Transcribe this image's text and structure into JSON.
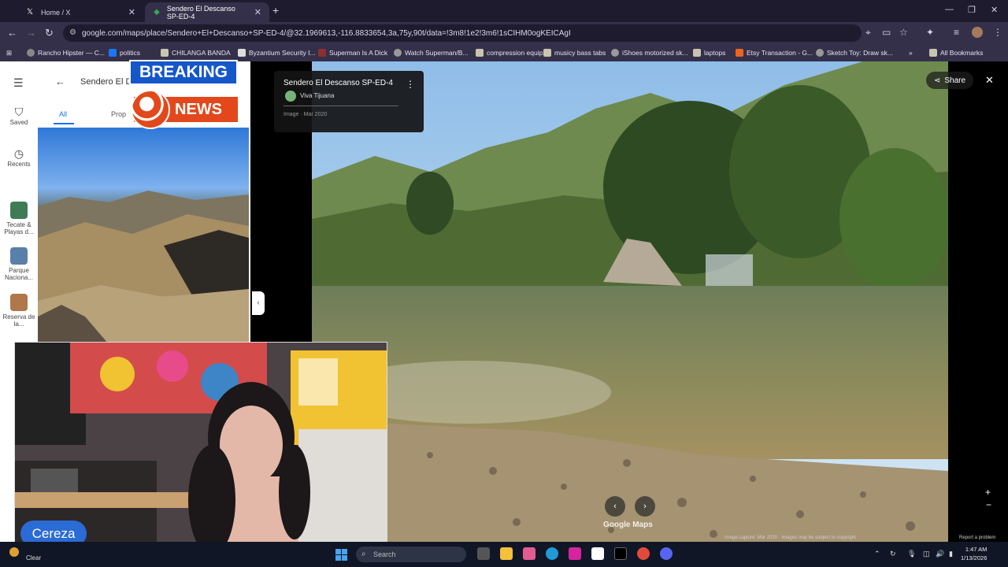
{
  "tabs": [
    {
      "label": "Home / X",
      "icon": "x-logo-icon"
    },
    {
      "label": "Sendero El Descanso SP-ED-4",
      "icon": "google-maps-icon"
    }
  ],
  "url": "google.com/maps/place/Sendero+El+Descanso+SP-ED-4/@32.1969613,-116.8833654,3a,75y,90t/data=!3m8!1e2!3m6!1sCIHM0ogKEICAgI",
  "bookmarks": [
    "Rancho Hipster — C...",
    "politics",
    "CHILANGA BANDA",
    "Byzantium Security I...",
    "Superman Is A Dick",
    "Watch Superman/B...",
    "compression equip",
    "musicy bass tabs",
    "iShoes motorized sk...",
    "laptops",
    "Etsy Transaction - G...",
    "Sketch Toy: Draw sk..."
  ],
  "all_bookmarks": "All Bookmarks",
  "rail": {
    "saved": "Saved",
    "recents": "Recents",
    "items": [
      "Tecate & Playas d...",
      "Parque Naciona...",
      "Reserva de la..."
    ]
  },
  "panel": {
    "title": "Sendero El De",
    "tab_all": "All",
    "tab_prop": "Prop"
  },
  "overlay": {
    "breaking": "BREAKING",
    "news": "NEWS"
  },
  "streetview": {
    "title": "Sendero El Descanso SP-ED-4",
    "owner": "Viva Tijuana",
    "date": "Image · Mar 2020",
    "share": "Share",
    "logo": "Google Maps",
    "footer": "Image capture: Mar 2020 · Images may be subject to copyright",
    "footer_right": "Report a problem"
  },
  "streamer_name": "Cereza",
  "taskbar": {
    "weather": "Clear",
    "search": "Search",
    "time": "1:47 AM",
    "date": "1/13/2026"
  }
}
